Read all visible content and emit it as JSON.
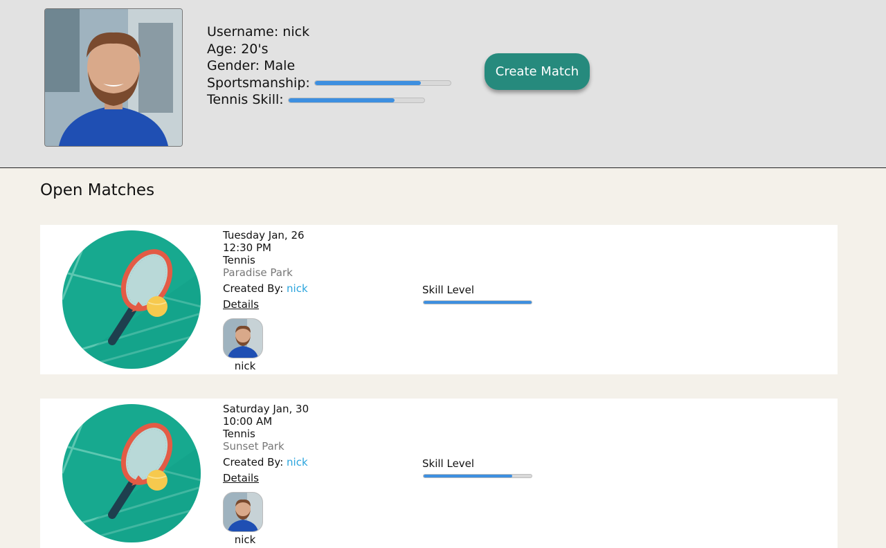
{
  "profile": {
    "username_label": "Username: nick",
    "age_label": "Age: 20's",
    "gender_label": "Gender: Male",
    "sportsmanship_label": "Sportsmanship:",
    "sportsmanship_level": 0.78,
    "tennis_skill_label": "Tennis Skill:",
    "tennis_skill_level": 0.78
  },
  "actions": {
    "create_match_label": "Create Match"
  },
  "open_matches": {
    "title": "Open Matches",
    "matches": [
      {
        "date": "Tuesday Jan, 26",
        "time": "12:30 PM",
        "sport": "Tennis",
        "venue": "Paradise Park",
        "created_by_label": "Created By:",
        "created_by": "nick",
        "details_label": "Details",
        "participant": "nick",
        "skill_label": "Skill Level",
        "skill_level": 1.0
      },
      {
        "date": "Saturday Jan, 30",
        "time": "10:00 AM",
        "sport": "Tennis",
        "venue": "Sunset Park",
        "created_by_label": "Created By:",
        "created_by": "nick",
        "details_label": "Details",
        "participant": "nick",
        "skill_label": "Skill Level",
        "skill_level": 0.82
      }
    ]
  },
  "colors": {
    "header_bg": "#e2e2e2",
    "page_bg": "#f4f1ea",
    "accent_button": "#268a7d",
    "bar_fill": "#3d8fe0",
    "link": "#2aa4dd",
    "court_green": "#17a98f"
  },
  "icons": {
    "profile_photo": "user-photo",
    "sport_image": "tennis-racket-ball-icon"
  }
}
